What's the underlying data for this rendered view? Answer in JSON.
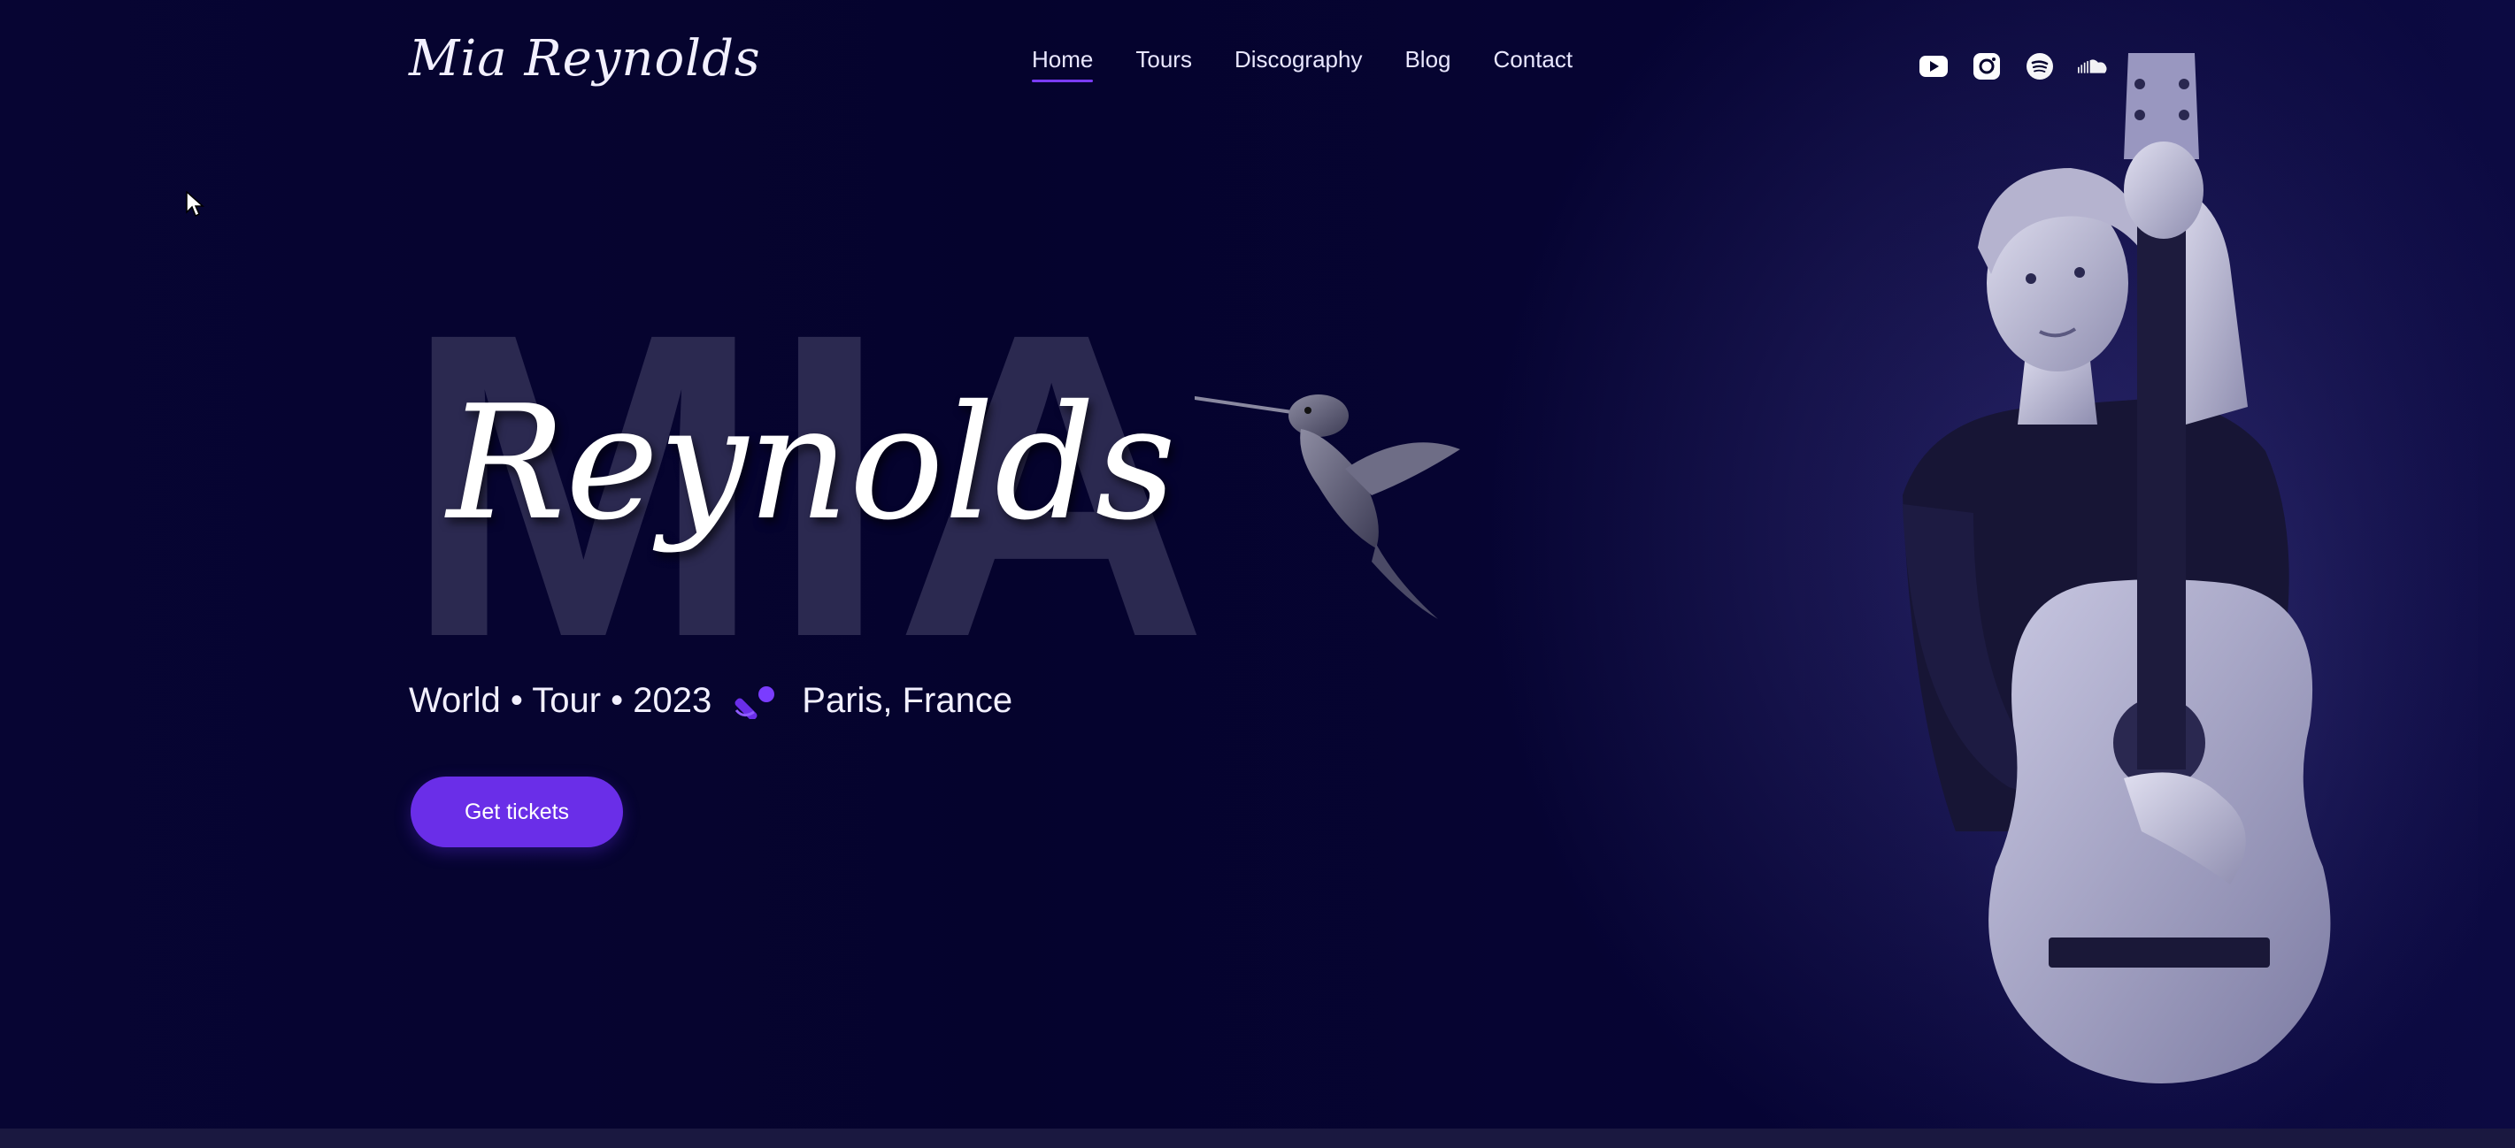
{
  "header": {
    "logo": "Mia Reynolds",
    "nav": [
      {
        "label": "Home",
        "active": true
      },
      {
        "label": "Tours",
        "active": false
      },
      {
        "label": "Discography",
        "active": false
      },
      {
        "label": "Blog",
        "active": false
      },
      {
        "label": "Contact",
        "active": false
      }
    ],
    "socials": [
      "youtube-icon",
      "instagram-icon",
      "spotify-icon",
      "soundcloud-icon"
    ]
  },
  "hero": {
    "background_word": "MIA",
    "script_name": "Reynolds",
    "tour_line": "World • Tour • 2023",
    "location": "Paris, France",
    "cta_label": "Get tickets"
  },
  "colors": {
    "background": "#05032d",
    "accent": "#6a2ee8",
    "nav_underline": "#7a3cff",
    "bg_word": "#2b2950"
  }
}
